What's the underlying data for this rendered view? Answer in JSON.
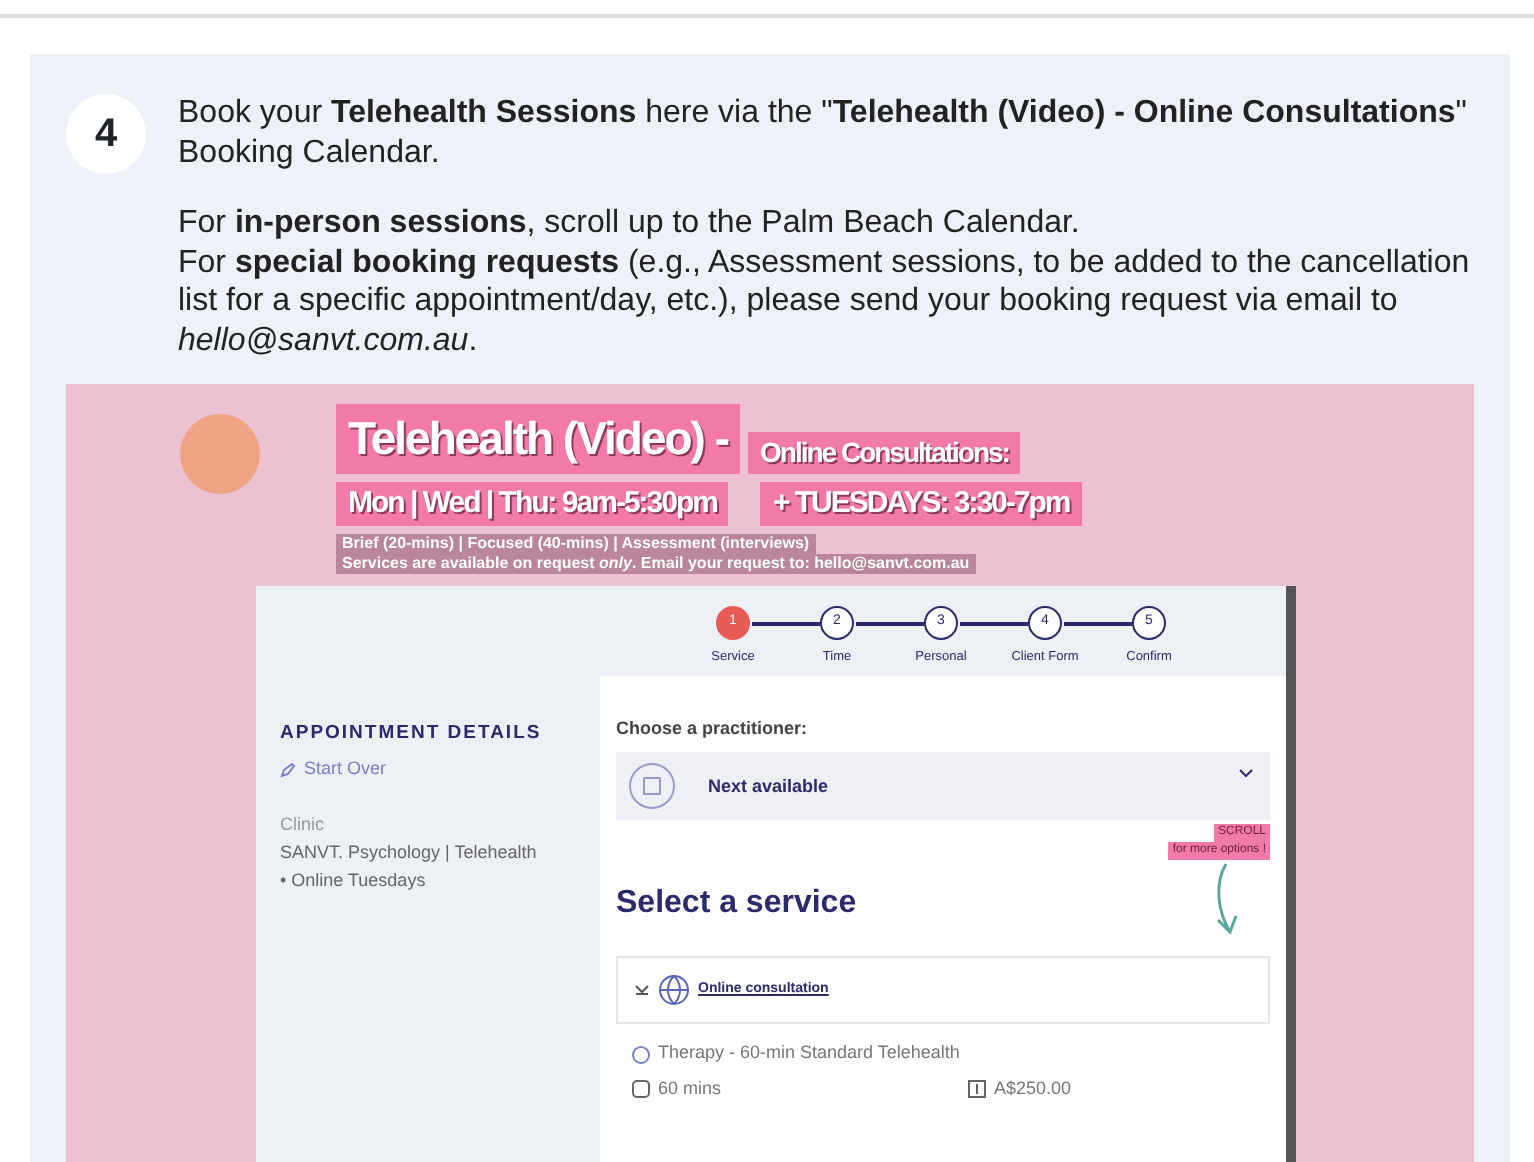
{
  "step": {
    "number": "4",
    "paragraphs": [
      {
        "lines": [
          "Book your **Telehealth Sessions** here via the \"**Telehealth (Video) - Online Consultations**\" Booking Calendar."
        ]
      },
      {
        "lines": [
          "For **in-person sessions**, scroll up to the Palm Beach Calendar.",
          "For **special booking requests** (e.g., Assessment sessions, to be added to the cancellation list for a specific appointment/day, etc.), please send your booking request via email to *hello@sanvt.com.au*."
        ]
      }
    ]
  },
  "screenshot": {
    "banner": {
      "title": "Telehealth (Video) -",
      "subtitle": "Online Consultations:",
      "hours": [
        "Mon | Wed | Thu: 9am-5:30pm",
        "+ TUESDAYS: 3:30-7pm"
      ],
      "notes": [
        "Brief (20-mins) | Focused (40-mins) | Assessment (interviews)",
        "Services are available on request *only*. Email your request to: hello@sanvt.com.au"
      ]
    },
    "steps": [
      {
        "number": "1",
        "label": "Service",
        "selected": true
      },
      {
        "number": "2",
        "label": "Time",
        "selected": false
      },
      {
        "number": "3",
        "label": "Personal",
        "selected": false
      },
      {
        "number": "4",
        "label": "Client Form",
        "selected": false
      },
      {
        "number": "5",
        "label": "Confirm",
        "selected": false
      }
    ],
    "appointment_details": {
      "heading": "APPOINTMENT DETAILS",
      "start_over": "Start Over",
      "clinic_label": "Clinic",
      "clinic_lines": [
        "SANVT. Psychology | Telehealth",
        "• Online Tuesdays"
      ]
    },
    "practitioner": {
      "label": "Choose a practitioner:",
      "value": "Next available"
    },
    "scroll_note": [
      "SCROLL",
      "for more options !"
    ],
    "service": {
      "heading": "Select a service",
      "category": "Online consultation",
      "item": {
        "name": "Therapy - 60-min Standard Telehealth",
        "duration": "60 mins",
        "price": "A$250.00"
      }
    }
  }
}
